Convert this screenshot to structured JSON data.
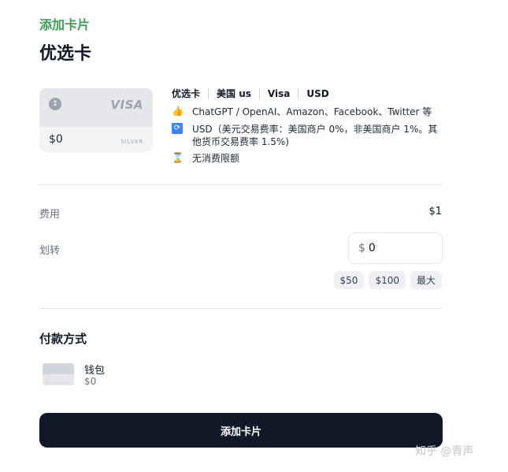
{
  "header": {
    "breadcrumb": "添加卡片",
    "title": "优选卡"
  },
  "card": {
    "brand": "VISA",
    "balance": "$0",
    "tier": "SILVER"
  },
  "details": {
    "tags": [
      "优选卡",
      "美国 us",
      "Visa",
      "USD"
    ],
    "features": [
      {
        "icon": "thumbs-up-icon",
        "text": "ChatGPT / OpenAI、Amazon、Facebook、Twitter 等"
      },
      {
        "icon": "currency-exchange-icon",
        "text": "USD（美元交易费率：美国商户 0%，非美国商户 1%。其他货币交易费率 1.5%)"
      },
      {
        "icon": "hourglass-icon",
        "text": "无消费限额"
      }
    ]
  },
  "fee": {
    "label": "费用",
    "value": "$1"
  },
  "transfer": {
    "label": "划转",
    "prefix": "$",
    "value": "0",
    "quick_amounts": [
      "$50",
      "$100",
      "最大"
    ]
  },
  "payment": {
    "title": "付款方式",
    "method_name": "钱包",
    "method_balance": "$0"
  },
  "actions": {
    "submit_label": "添加卡片"
  },
  "watermark": "知乎 @青声"
}
